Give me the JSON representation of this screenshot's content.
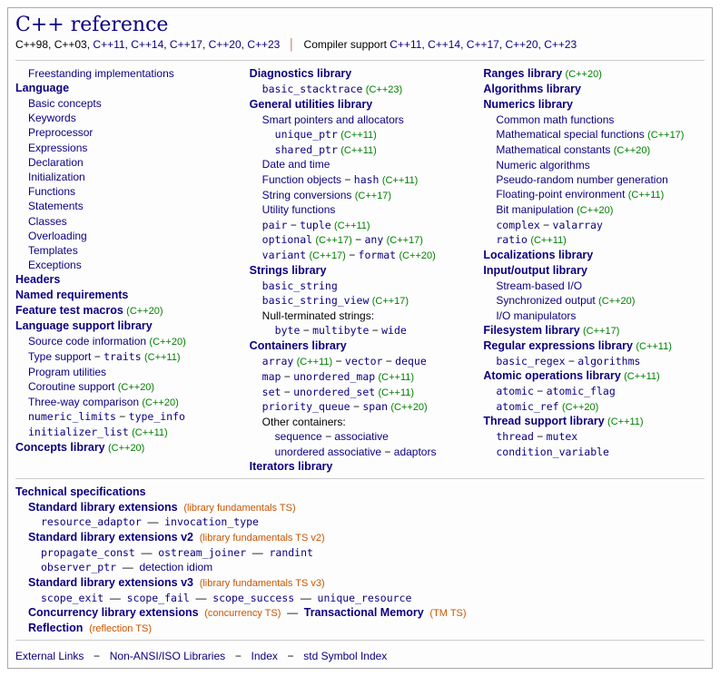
{
  "title": "C++ reference",
  "subhead": {
    "left": [
      "C++98",
      "C++03",
      "C++11",
      "C++14",
      "C++17",
      "C++20",
      "C++23"
    ],
    "right_prefix": "Compiler support",
    "right": [
      "C++11",
      "C++14",
      "C++17",
      "C++20",
      "C++23"
    ]
  },
  "col1": {
    "freestanding": "Freestanding implementations",
    "language": "Language",
    "language_items": [
      "Basic concepts",
      "Keywords",
      "Preprocessor",
      "Expressions",
      "Declaration",
      "Initialization",
      "Functions",
      "Statements",
      "Classes",
      "Overloading",
      "Templates",
      "Exceptions"
    ],
    "headers": "Headers",
    "named_req": "Named requirements",
    "ftm": {
      "label": "Feature test macros",
      "tag": "(C++20)"
    },
    "lang_support": "Language support library",
    "ls_src_info": {
      "label": "Source code information",
      "tag": "(C++20)"
    },
    "ls_type": {
      "a": "Type support",
      "b": "traits",
      "tag": "(C++11)"
    },
    "ls_prog_util": "Program utilities",
    "ls_coroutine": {
      "label": "Coroutine support",
      "tag": "(C++20)"
    },
    "ls_three_way": {
      "label": "Three-way comparison",
      "tag": "(C++20)"
    },
    "ls_row6": {
      "a": "numeric_limits",
      "b": "type_info"
    },
    "ls_init_list": {
      "label": "initializer_list",
      "tag": "(C++11)"
    },
    "concepts": {
      "label": "Concepts library",
      "tag": "(C++20)"
    }
  },
  "col2": {
    "diagnostics": "Diagnostics library",
    "stacktrace": {
      "label": "basic_stacktrace",
      "tag": "(C++23)"
    },
    "general": "General utilities library",
    "gen_smart": "Smart pointers and allocators",
    "gen_unique": {
      "label": "unique_ptr",
      "tag": "(C++11)"
    },
    "gen_shared": {
      "label": "shared_ptr",
      "tag": "(C++11)"
    },
    "gen_date": "Date and time",
    "gen_func_obj": {
      "a": "Function objects",
      "b": "hash",
      "tag": "(C++11)"
    },
    "gen_string_conv": {
      "label": "String conversions",
      "tag": "(C++17)"
    },
    "gen_util": "Utility functions",
    "gen_pair_tuple": {
      "a": "pair",
      "b": "tuple",
      "tag": "(C++11)"
    },
    "gen_opt_any": {
      "a": "optional",
      "atag": "(C++17)",
      "b": "any",
      "btag": "(C++17)"
    },
    "gen_var_fmt": {
      "a": "variant",
      "atag": "(C++17)",
      "b": "format",
      "btag": "(C++20)"
    },
    "strings": "Strings library",
    "str_basic": "basic_string",
    "str_view": {
      "label": "basic_string_view",
      "tag": "(C++17)"
    },
    "str_nullterm": "Null-terminated strings:",
    "str_list": {
      "a": "byte",
      "b": "multibyte",
      "c": "wide"
    },
    "containers": "Containers library",
    "c_array": {
      "a": "array",
      "atag": "(C++11)",
      "b": "vector",
      "c": "deque"
    },
    "c_map": {
      "a": "map",
      "b": "unordered_map",
      "tag": "(C++11)"
    },
    "c_set": {
      "a": "set",
      "b": "unordered_set",
      "tag": "(C++11)"
    },
    "c_pq_span": {
      "a": "priority_queue",
      "b": "span",
      "tag": "(C++20)"
    },
    "c_other_label": "Other containers:",
    "c_other1": {
      "a": "sequence",
      "b": "associative"
    },
    "c_other2": {
      "a": "unordered associative",
      "b": "adaptors"
    },
    "iterators": "Iterators library"
  },
  "col3": {
    "ranges": {
      "label": "Ranges library",
      "tag": "(C++20)"
    },
    "algorithms": "Algorithms library",
    "numerics": "Numerics library",
    "num_common": "Common math functions",
    "num_special": {
      "label": "Mathematical special functions",
      "tag": "(C++17)"
    },
    "num_const": {
      "label": "Mathematical constants",
      "tag": "(C++20)"
    },
    "num_algo": "Numeric algorithms",
    "num_random": "Pseudo-random number generation",
    "num_float": {
      "label": "Floating-point environment",
      "tag": "(C++11)"
    },
    "num_bit": {
      "label": "Bit manipulation",
      "tag": "(C++20)"
    },
    "num_complex": {
      "a": "complex",
      "b": "valarray"
    },
    "num_ratio": {
      "label": "ratio",
      "tag": "(C++11)"
    },
    "localizations": "Localizations library",
    "io": "Input/output library",
    "io_stream": "Stream-based I/O",
    "io_sync": {
      "label": "Synchronized output",
      "tag": "(C++20)"
    },
    "io_manip": "I/O manipulators",
    "filesystem": {
      "label": "Filesystem library",
      "tag": "(C++17)"
    },
    "regex": {
      "label": "Regular expressions library",
      "tag": "(C++11)"
    },
    "regex_items": {
      "a": "basic_regex",
      "b": "algorithms"
    },
    "atomic": {
      "label": "Atomic operations library",
      "tag": "(C++11)"
    },
    "atomic_row1": {
      "a": "atomic",
      "b": "atomic_flag"
    },
    "atomic_row2": {
      "label": "atomic_ref",
      "tag": "(C++20)"
    },
    "thread": {
      "label": "Thread support library",
      "tag": "(C++11)"
    },
    "thread_row1": {
      "a": "thread",
      "b": "mutex"
    },
    "thread_row2": "condition_variable"
  },
  "bottom": {
    "techspec": "Technical specifications",
    "sle1": {
      "label": "Standard library extensions",
      "note": "(library fundamentals TS)"
    },
    "sle1_items": {
      "a": "resource_adaptor",
      "b": "invocation_type"
    },
    "sle2": {
      "label": "Standard library extensions v2",
      "note": "(library fundamentals TS v2)"
    },
    "sle2_row1": {
      "a": "propagate_const",
      "b": "ostream_joiner",
      "c": "randint"
    },
    "sle2_row2": {
      "a": "observer_ptr",
      "b": "detection idiom"
    },
    "sle3": {
      "label": "Standard library extensions v3",
      "note": "(library fundamentals TS v3)"
    },
    "sle3_items": {
      "a": "scope_exit",
      "b": "scope_fail",
      "c": "scope_success",
      "d": "unique_resource"
    },
    "conc": {
      "label": "Concurrency library extensions",
      "note": "(concurrency TS)",
      "extra": "Transactional Memory",
      "extranote": "(TM TS)"
    },
    "refl": {
      "label": "Reflection",
      "note": "(reflection TS)"
    }
  },
  "footer": {
    "items": [
      "External Links",
      "Non-ANSI/ISO Libraries",
      "Index",
      "std Symbol Index"
    ]
  }
}
